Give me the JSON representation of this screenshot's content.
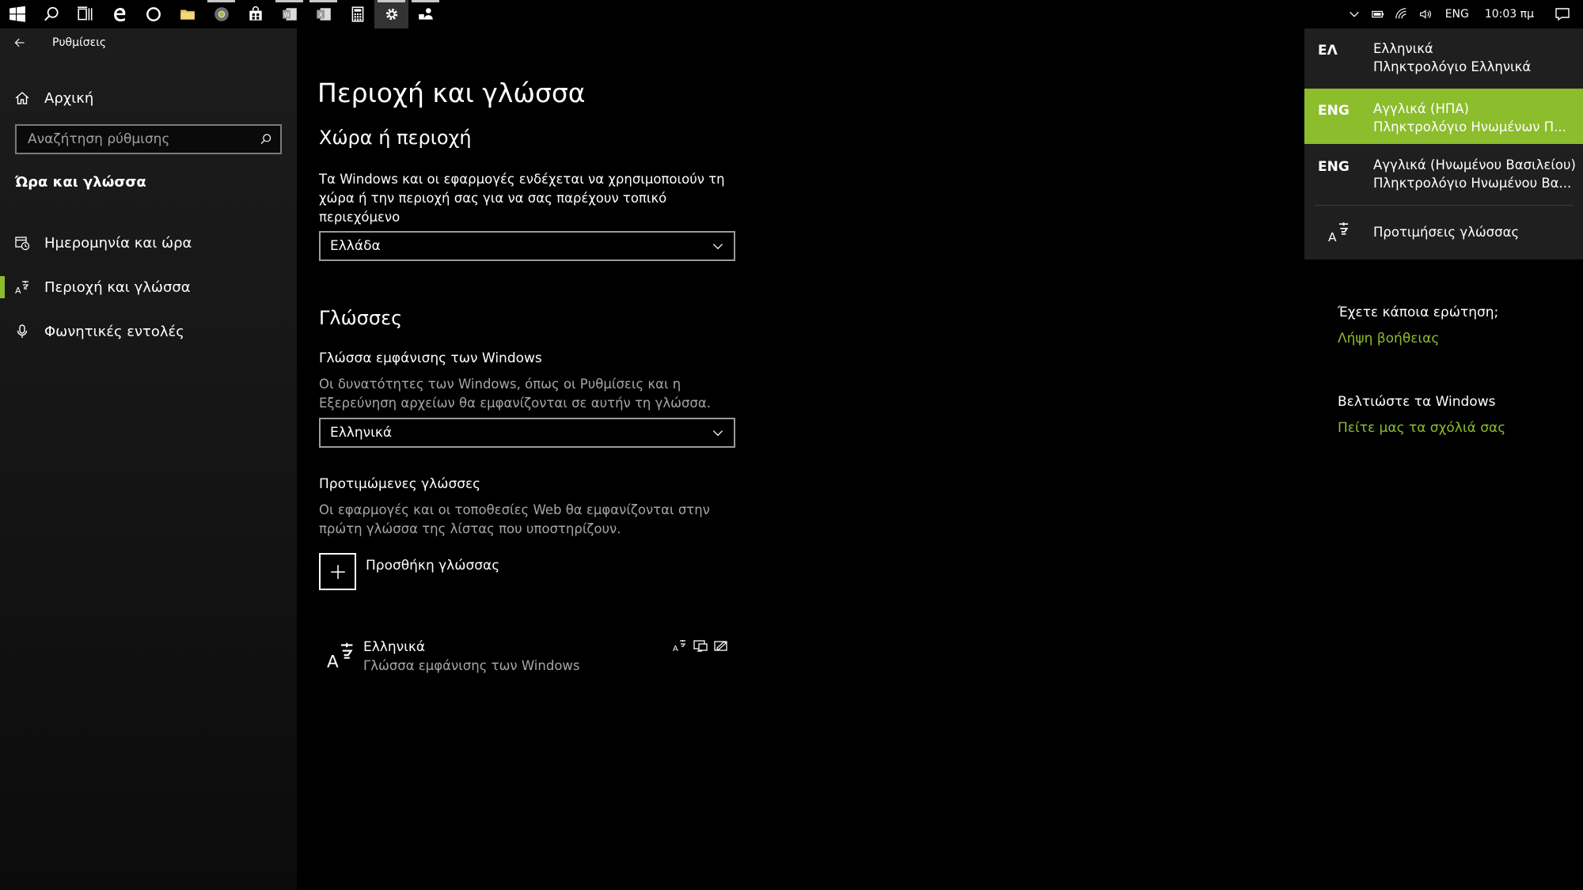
{
  "taskbar": {
    "apps": [
      {
        "icon": "windows-start-icon"
      },
      {
        "icon": "search-icon"
      },
      {
        "icon": "task-view-icon"
      },
      {
        "icon": "edge-browser-icon"
      },
      {
        "icon": "cortana-icon"
      },
      {
        "icon": "file-explorer-icon"
      },
      {
        "icon": "chrome-icon"
      },
      {
        "icon": "store-icon"
      },
      {
        "icon": "word-icon"
      },
      {
        "icon": "excel-icon"
      },
      {
        "icon": "calculator-icon"
      },
      {
        "icon": "settings-gear-icon"
      },
      {
        "icon": "people-icon"
      }
    ],
    "language": "ENG",
    "time": "10:03 πμ"
  },
  "window": {
    "title": "Ρυθμίσεις"
  },
  "sidebar": {
    "home": "Αρχική",
    "search_placeholder": "Αναζήτηση ρύθμισης",
    "section": "Ώρα και γλώσσα",
    "items": [
      {
        "label": "Ημερομηνία και ώρα",
        "icon": "calendar-clock-icon"
      },
      {
        "label": "Περιοχή και γλώσσα",
        "icon": "language-icon"
      },
      {
        "label": "Φωνητικές εντολές",
        "icon": "microphone-icon"
      }
    ]
  },
  "main": {
    "title": "Περιοχή και γλώσσα",
    "region": {
      "heading": "Χώρα ή περιοχή",
      "description": "Τα Windows και οι εφαρμογές ενδέχεται να χρησιμοποιούν τη χώρα ή την περιοχή σας για να σας παρέχουν τοπικό περιεχόμενο",
      "selected": "Ελλάδα"
    },
    "languages": {
      "heading": "Γλώσσες",
      "display_label": "Γλώσσα εμφάνισης των Windows",
      "display_description": "Οι δυνατότητες των Windows, όπως οι Ρυθμίσεις και η Εξερεύνηση αρχείων θα εμφανίζονται σε αυτήν τη γλώσσα.",
      "display_selected": "Ελληνικά",
      "preferred_label": "Προτιμώμενες γλώσσες",
      "preferred_description": "Οι εφαρμογές και οι τοποθεσίες Web θα εμφανίζονται στην πρώτη γλώσσα της λίστας που υποστηρίζουν.",
      "add_label": "Προσθήκη γλώσσας",
      "list": [
        {
          "name": "Ελληνικά",
          "subtitle": "Γλώσσα εμφάνισης των Windows"
        }
      ]
    }
  },
  "help": {
    "question": "Έχετε κάποια ερώτηση;",
    "get_help": "Λήψη βοήθειας",
    "improve": "Βελτιώστε τα Windows",
    "feedback": "Πείτε μας τα σχόλιά σας"
  },
  "flyout": {
    "items": [
      {
        "code": "ΕΛ",
        "name": "Ελληνικά",
        "keyboard": "Πληκτρολόγιο Ελληνικά"
      },
      {
        "code": "ENG",
        "name": "Αγγλικά (ΗΠΑ)",
        "keyboard": "Πληκτρολόγιο Ηνωμένων Π..."
      },
      {
        "code": "ENG",
        "name": "Αγγλικά (Ηνωμένου Βασιλείου)",
        "keyboard": "Πληκτρολόγιο Ηνωμένου Βα..."
      }
    ],
    "selected_index": 1,
    "preferences": "Προτιμήσεις γλώσσας"
  },
  "colors": {
    "accent": "#8cbd2d",
    "flyout_bg": "#1f1f1f",
    "muted_text": "#a6a6a6"
  }
}
